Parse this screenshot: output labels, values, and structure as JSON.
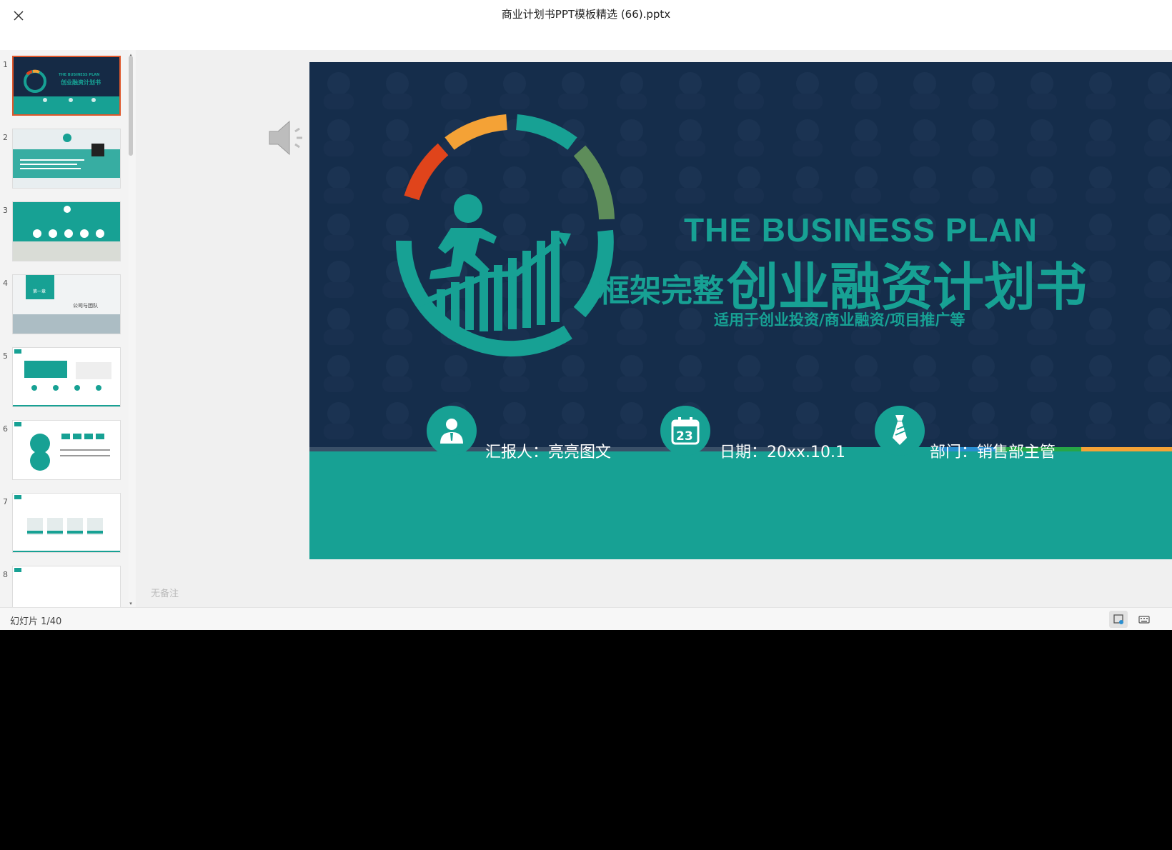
{
  "window": {
    "title": "商业计划书PPT模板精选 (66).pptx"
  },
  "thumbnails": [
    {
      "num": "1",
      "mini_en": "THE BUSINESS PLAN",
      "mini_cn": "创业融资计划书"
    },
    {
      "num": "2"
    },
    {
      "num": "3"
    },
    {
      "num": "4",
      "mini_cn": "第一章",
      "mini_cn2": "公司与团队"
    },
    {
      "num": "5"
    },
    {
      "num": "6"
    },
    {
      "num": "7"
    },
    {
      "num": "8"
    }
  ],
  "slide": {
    "title_en": "THE BUSINESS PLAN",
    "title_small": "框架完整",
    "title_big": "创业融资计划书",
    "subtitle": "适用于创业投资/商业融资/项目推广等",
    "reporter": "汇报人：亮亮图文",
    "date": "日期：20xx.10.1",
    "dept": "部门：销售部主管",
    "calendar_day": "23",
    "colors": {
      "teal": "#17a194",
      "navy": "#152a45",
      "orange": "#f4a236",
      "red": "#e0441b",
      "green": "#5e8d5a"
    }
  },
  "notes": {
    "placeholder": "无备注"
  },
  "status": {
    "slide_counter": "幻灯片 1/40"
  },
  "icons": [
    "close-icon",
    "speaker-icon",
    "person-icon",
    "calendar-icon",
    "tie-icon",
    "notes-view-icon",
    "keyboard-icon"
  ]
}
